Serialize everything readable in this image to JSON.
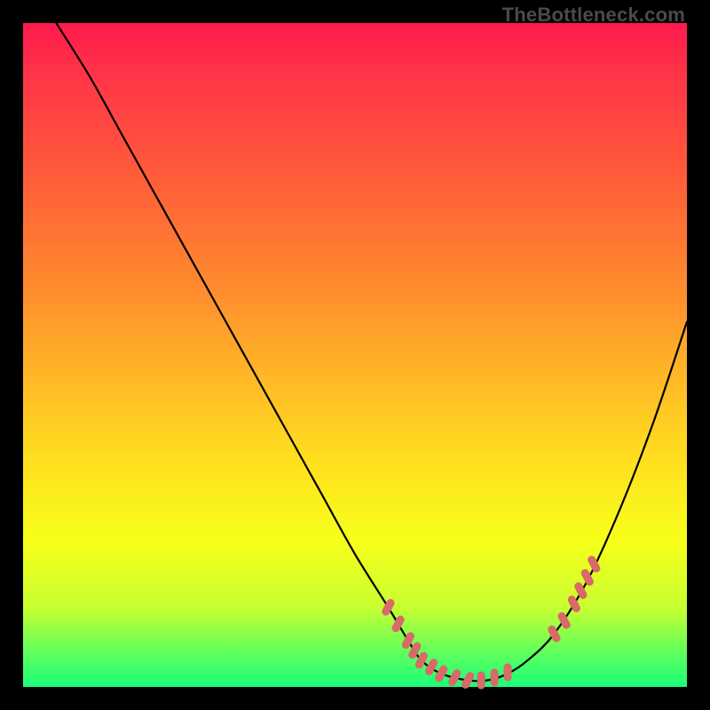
{
  "watermark": "TheBottleneck.com",
  "chart_data": {
    "type": "line",
    "title": "",
    "xlabel": "",
    "ylabel": "",
    "xlim": [
      0,
      100
    ],
    "ylim": [
      0,
      100
    ],
    "series": [
      {
        "name": "bottleneck-curve",
        "x": [
          5,
          10,
          15,
          20,
          25,
          30,
          35,
          40,
          45,
          50,
          55,
          58,
          60,
          63,
          67,
          70,
          73,
          76,
          80,
          85,
          90,
          95,
          100
        ],
        "y": [
          100,
          92,
          83,
          74,
          65,
          56,
          47,
          38,
          29,
          20,
          12,
          7,
          4,
          2,
          1,
          1,
          2,
          4,
          8,
          16,
          27,
          40,
          55
        ]
      }
    ],
    "markers": [
      {
        "name": "left-dash-cluster",
        "color": "#d86a6a",
        "points": [
          {
            "x": 55,
            "y": 12
          },
          {
            "x": 56.5,
            "y": 9.5
          },
          {
            "x": 58,
            "y": 7
          },
          {
            "x": 59,
            "y": 5.5
          },
          {
            "x": 60,
            "y": 4
          },
          {
            "x": 61.5,
            "y": 3
          },
          {
            "x": 63,
            "y": 2
          },
          {
            "x": 65,
            "y": 1.4
          },
          {
            "x": 67,
            "y": 1
          },
          {
            "x": 69,
            "y": 1
          },
          {
            "x": 71,
            "y": 1.4
          },
          {
            "x": 73,
            "y": 2.2
          }
        ]
      },
      {
        "name": "right-dash-cluster",
        "color": "#d86a6a",
        "points": [
          {
            "x": 80,
            "y": 8
          },
          {
            "x": 81.5,
            "y": 10
          },
          {
            "x": 83,
            "y": 12.5
          },
          {
            "x": 84,
            "y": 14.5
          },
          {
            "x": 85,
            "y": 16.5
          },
          {
            "x": 86,
            "y": 18.5
          }
        ]
      }
    ]
  }
}
